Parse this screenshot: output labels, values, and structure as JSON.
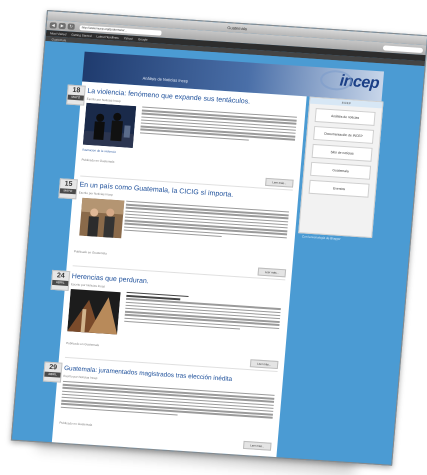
{
  "browser": {
    "window_title": "Guatemala",
    "url": "http://www.incep.org/guatemala/...",
    "bookmarks": [
      "Most Visited",
      "Getting Started",
      "Latest Headlines",
      "Yahoo!",
      "Google"
    ],
    "tabs": [
      "Guatemala"
    ],
    "back_glyph": "◀",
    "forward_glyph": "▶",
    "reload_glyph": "↻"
  },
  "banner": {
    "logo": "incep",
    "blog_name": "Análisis de Noticias Incep"
  },
  "sidebar": {
    "header": "INCEP",
    "items": [
      "Análisis de noticias",
      "Documentación de INCEP",
      "Sitio de noticias",
      "Guatemala",
      "Eventos"
    ],
    "note": "Con la tecnología de Blogger"
  },
  "posts": [
    {
      "day": "18",
      "month": "MAYO",
      "title": "La violencia: fenómeno que expande sus tentáculos.",
      "meta": "Escrito por Noticias Incep",
      "caption": "Ilustración de la violencia",
      "posted": "Publicado en Guatemala",
      "read_more": "Leer más..."
    },
    {
      "day": "15",
      "month": "MAYO",
      "title": "En un país como Guatemala, la CICIG sí importa.",
      "meta": "Escrito por Noticias Incep",
      "posted": "Publicado en Guatemala",
      "read_more": "Leer más..."
    },
    {
      "day": "24",
      "month": "ABRIL",
      "title": "Herencias que perduran.",
      "meta": "Escrito por Noticias Incep",
      "posted": "Publicado en Guatemala",
      "read_more": "Leer más..."
    },
    {
      "day": "29",
      "month": "ABRIL",
      "title": "Guatemala: juramentados magistrados tras elección inédita",
      "meta": "Escrito por Noticias Incep",
      "posted": "Publicado en Guatemala",
      "read_more": "Leer más..."
    }
  ],
  "colors": {
    "page_background": "#4b9bd3",
    "banner_dark": "#1f3b6e",
    "logo_blue": "#1b3f86",
    "title_blue": "#1d4f9a"
  }
}
